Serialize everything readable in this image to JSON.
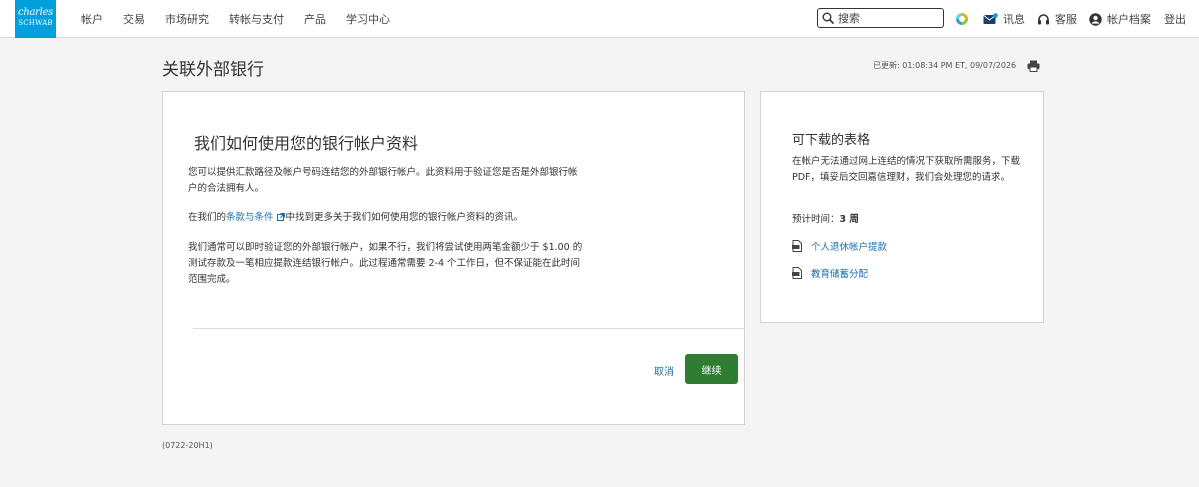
{
  "brand": {
    "line1": "charles",
    "line2": "SCHWAB",
    "color": "#00a0df"
  },
  "nav": {
    "items": [
      "帐户",
      "交易",
      "市场研究",
      "转帐与支付",
      "产品",
      "学习中心"
    ]
  },
  "search": {
    "placeholder": "搜索",
    "value": ""
  },
  "utility": {
    "messages": "讯息",
    "service": "客服",
    "profile": "帐户档案",
    "logout": "登出"
  },
  "page": {
    "title": "关联外部银行",
    "updated": "已更新: 01:08:34 PM ET, 09/07/2026"
  },
  "main_card": {
    "heading": "我们如何使用您的银行帐户资料",
    "para1": "您可以提供汇款路径及帐户号码连结您的外部银行帐户。此资料用于验证您是否是外部银行帐户的合法拥有人。",
    "para2_before": "在我们的",
    "para2_link": "条款与条件",
    "para2_after": "中找到更多关于我们如何使用您的银行帐户资料的资讯。",
    "para3": "我们通常可以即时验证您的外部银行帐户，如果不行，我们将尝试使用两笔金额少于 $1.00 的测试存款及一笔相应提款连结银行帐户。此过程通常需要 2-4 个工作日，但不保证能在此时间范围完成。",
    "cancel": "取消",
    "continue": "继续"
  },
  "side_card": {
    "heading": "可下载的表格",
    "desc": "在帐户无法通过网上连结的情况下获取所需服务，下载 PDF，填妥后交回嘉信理财，我们会处理您的请求。",
    "eta_label": "预计时间：",
    "eta_value": "3 周",
    "links": [
      "个人退休帐户提款",
      "教育储蓄分配"
    ]
  },
  "footer": {
    "code": "(0722-20H1)"
  },
  "colors": {
    "link": "#1a6fb4",
    "primary_button": "#2e7d32",
    "background": "#f4f4f4"
  }
}
